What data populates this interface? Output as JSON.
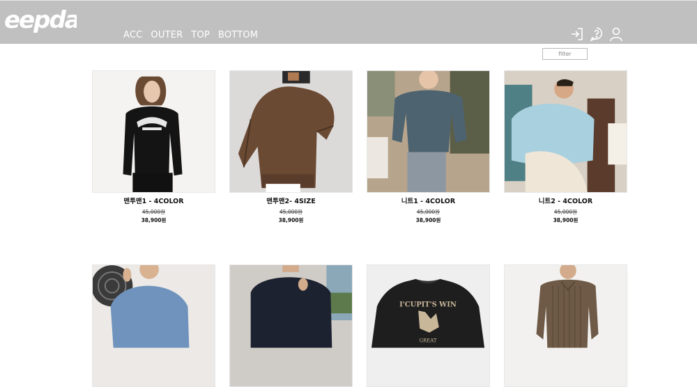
{
  "header": {
    "logo_text": "eepda",
    "nav": [
      "ACC",
      "OUTER",
      "TOP",
      "BOTTOM"
    ],
    "icons": [
      "login-icon",
      "help-icon",
      "user-icon"
    ]
  },
  "filter": {
    "label": "filter"
  },
  "products": [
    {
      "name": "맨투맨1 - 4COLOR",
      "original_price": "45,000원",
      "sale_price": "38,900원",
      "image": "black-sweatshirt",
      "colors": {
        "bg": "#f4f3f1",
        "garment": "#141414"
      }
    },
    {
      "name": "맨투맨2- 4SIZE",
      "original_price": "45,000원",
      "sale_price": "38,900원",
      "image": "brown-knit",
      "colors": {
        "bg": "#dcdad8",
        "garment": "#6b4a34"
      }
    },
    {
      "name": "니트1 - 4COLOR",
      "original_price": "45,000원",
      "sale_price": "38,900원",
      "image": "gray-blue-knit",
      "colors": {
        "bg": "#b7a48c",
        "garment": "#4d6370"
      }
    },
    {
      "name": "니트2 - 4COLOR",
      "original_price": "45,000원",
      "sale_price": "38,900원",
      "image": "light-blue-knit",
      "colors": {
        "bg": "#d8d0c4",
        "garment": "#a9d0de"
      }
    },
    {
      "image": "blue-knit",
      "colors": {
        "bg": "#ece9e6",
        "garment": "#6f93bd"
      }
    },
    {
      "image": "navy-sweater",
      "colors": {
        "bg": "#cfcbc6",
        "garment": "#1d2230"
      }
    },
    {
      "image": "graphic-sweatshirt",
      "colors": {
        "bg": "#efefef",
        "garment": "#1e1e1e"
      }
    },
    {
      "image": "striped-shirt",
      "colors": {
        "bg": "#f2f1ef",
        "garment": "#6e5a47"
      }
    }
  ]
}
